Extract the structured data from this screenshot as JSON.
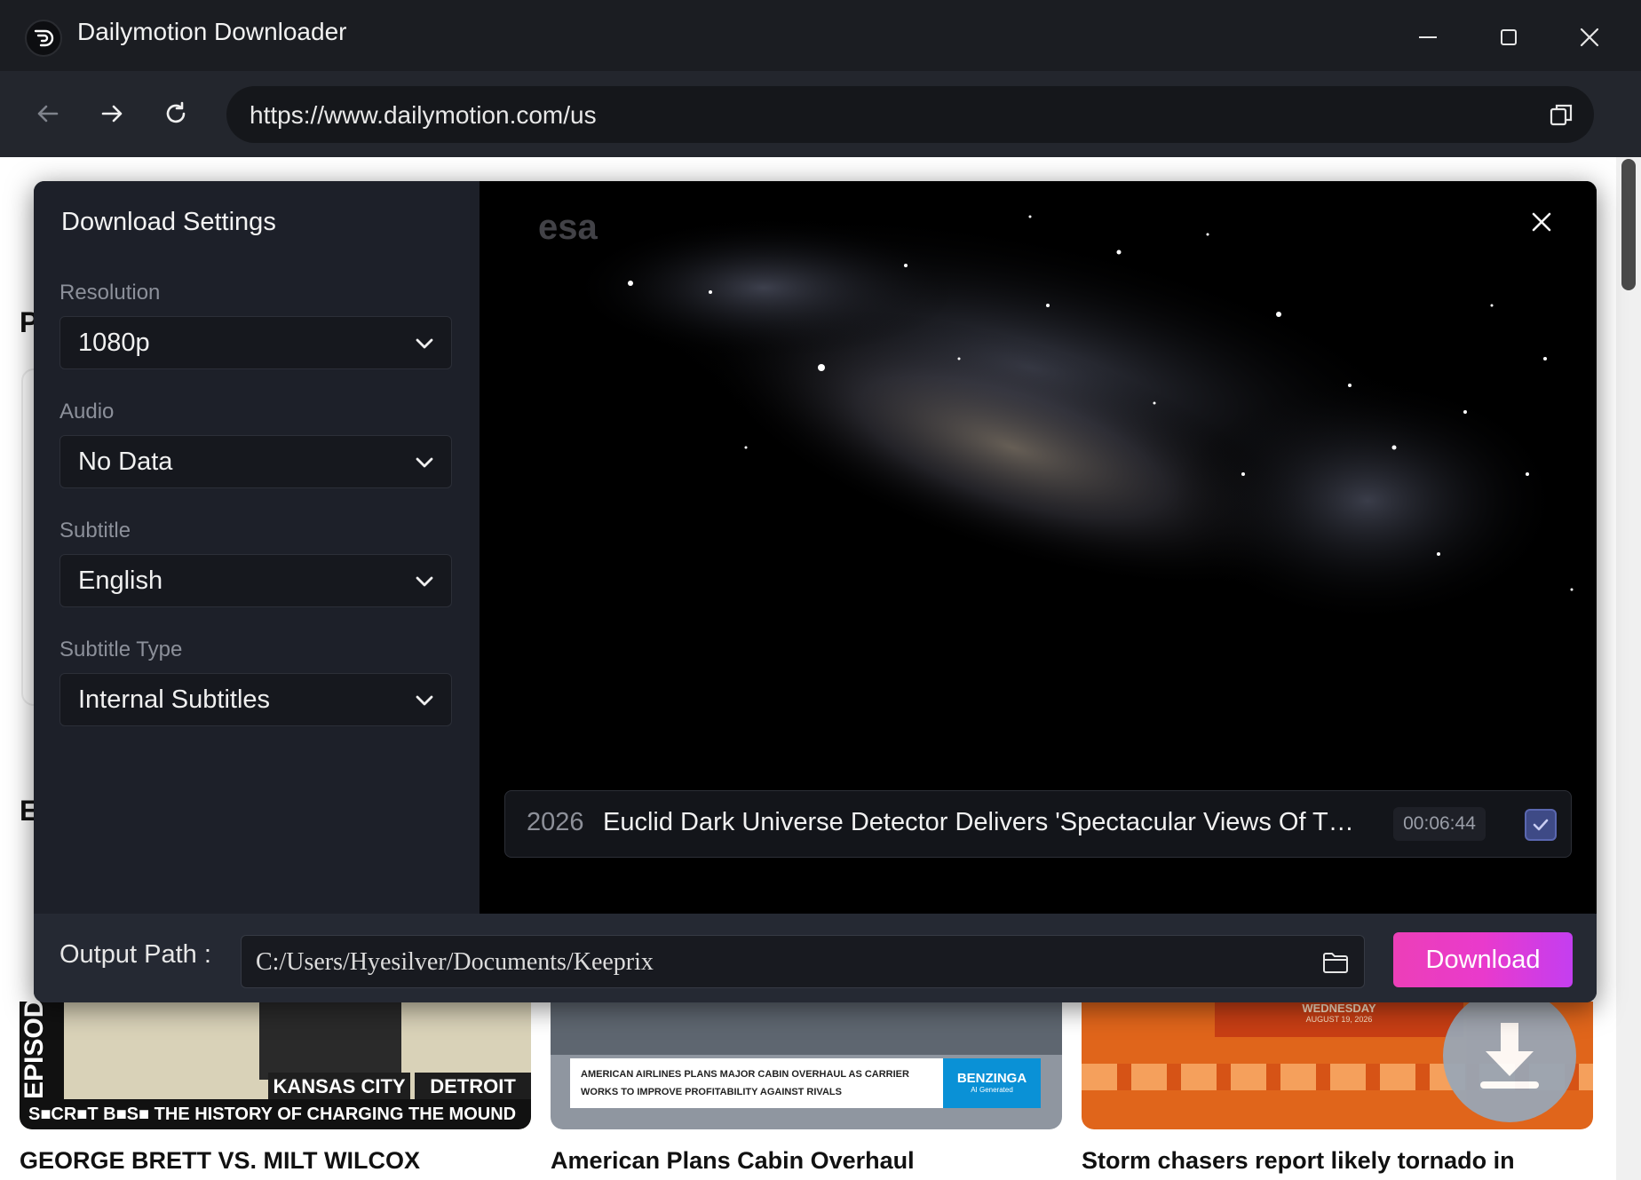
{
  "window": {
    "title": "Dailymotion Downloader"
  },
  "navigation": {
    "url": "https://www.dailymotion.com/us"
  },
  "page": {
    "peek_letters": [
      "P",
      "E"
    ],
    "thumb1": {
      "band_text": "S■CR■T B■S■  THE HISTORY OF CHARGING THE MOUND",
      "panel_left": "KANSAS CITY",
      "panel_right": "DETROIT",
      "vertical_text": "EPISODE"
    },
    "thumb2": {
      "banner_text": "AMERICAN AIRLINES PLANS MAJOR CABIN OVERHAUL AS CARRIER WORKS TO IMPROVE PROFITABILITY AGAINST RIVALS",
      "logo_text": "BENZINGA",
      "logo_subtext": "AI Generated"
    },
    "thumb3": {
      "date_text": "WEDNESDAY",
      "date_subtext": "AUGUST 19, 2026"
    },
    "video_titles": [
      "GEORGE BRETT VS. MILT WILCOX",
      "American Plans Cabin Overhaul",
      "Storm chasers report likely tornado in"
    ]
  },
  "modal": {
    "title": "Download Settings",
    "fields": {
      "resolution": {
        "label": "Resolution",
        "value": "1080p"
      },
      "audio": {
        "label": "Audio",
        "value": "No Data"
      },
      "subtitle": {
        "label": "Subtitle",
        "value": "English"
      },
      "subtitle_type": {
        "label": "Subtitle Type",
        "value": "Internal Subtitles"
      }
    },
    "preview": {
      "watermark": "esa"
    },
    "video": {
      "year": "2026",
      "title": "Euclid Dark Universe Detector Delivers 'Spectacular Views Of The Universe'",
      "duration": "00:06:44",
      "checked": true
    },
    "output": {
      "label": "Output Path :",
      "path": "C:/Users/Hyesilver/Documents/Keeprix"
    },
    "download_label": "Download"
  },
  "colors": {
    "accent_gradient_start": "#ec3fb8",
    "accent_gradient_end": "#c43ef0",
    "modal_bg": "#1b1e26",
    "titlebar_bg": "#1b1d22"
  },
  "icons": {
    "back": "arrow-left-icon",
    "forward": "arrow-right-icon",
    "reload": "reload-icon",
    "copy": "copy-icon",
    "minimize": "minimize-icon",
    "maximize": "maximize-icon",
    "close": "close-icon",
    "folder": "folder-icon",
    "check": "check-icon",
    "chevron": "chevron-down-icon",
    "download": "download-arrow-icon"
  }
}
